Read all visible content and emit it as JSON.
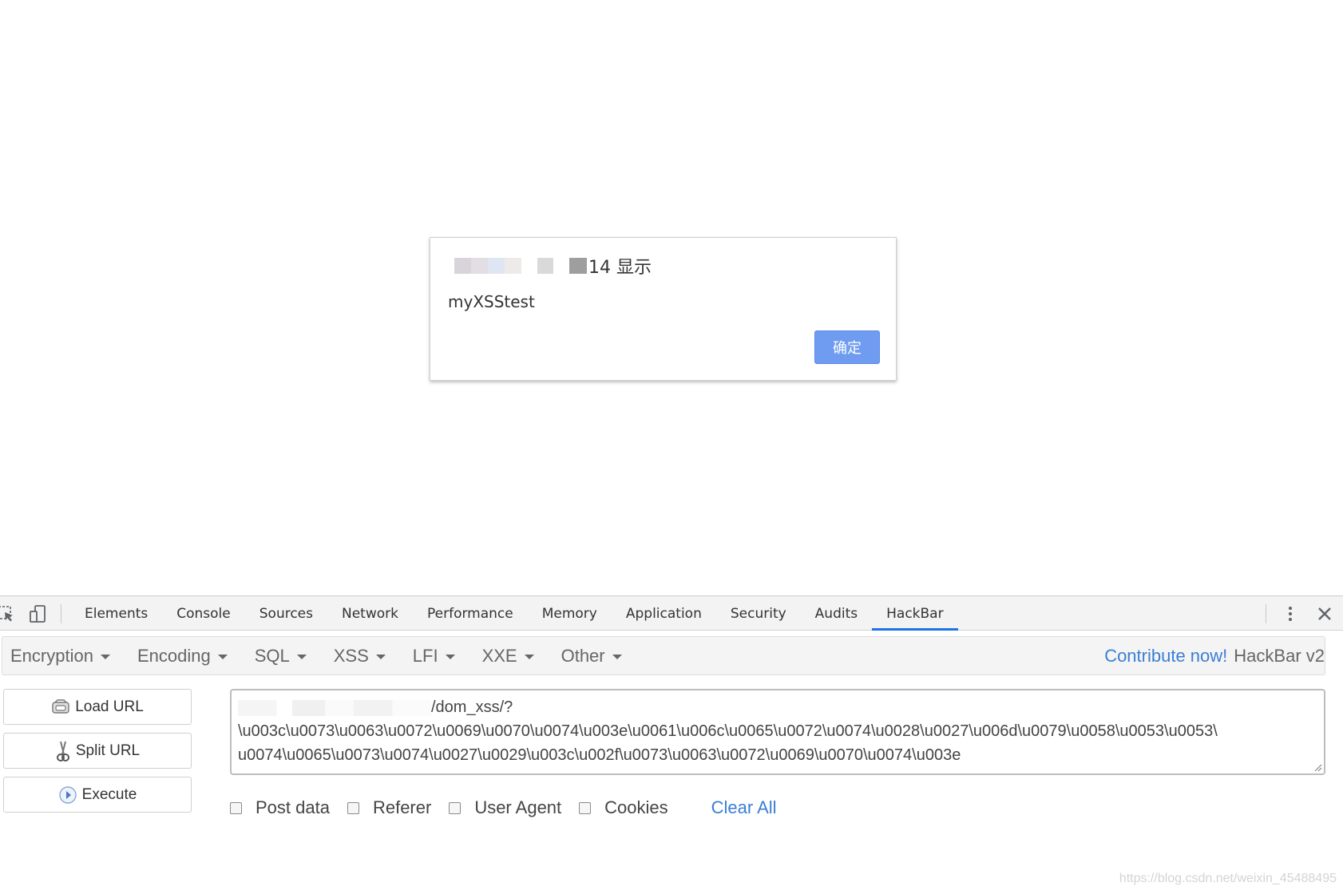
{
  "dialog": {
    "title_suffix": "14 显示",
    "message": "myXSStest",
    "ok_label": "确定"
  },
  "devtools": {
    "tabs": [
      {
        "label": "Elements"
      },
      {
        "label": "Console"
      },
      {
        "label": "Sources"
      },
      {
        "label": "Network"
      },
      {
        "label": "Performance"
      },
      {
        "label": "Memory"
      },
      {
        "label": "Application"
      },
      {
        "label": "Security"
      },
      {
        "label": "Audits"
      },
      {
        "label": "HackBar"
      }
    ],
    "active_tab": "HackBar",
    "accent_color": "#1a73e8"
  },
  "hackbar": {
    "menu": [
      {
        "label": "Encryption"
      },
      {
        "label": "Encoding"
      },
      {
        "label": "SQL"
      },
      {
        "label": "XSS"
      },
      {
        "label": "LFI"
      },
      {
        "label": "XXE"
      },
      {
        "label": "Other"
      }
    ],
    "contribute_label": "Contribute now!",
    "version_label": "HackBar v2",
    "buttons": {
      "load_url": "Load URL",
      "split_url": "Split URL",
      "execute": "Execute"
    },
    "url": {
      "line1_suffix": "/dom_xss/?",
      "line2": "\\u003c\\u0073\\u0063\\u0072\\u0069\\u0070\\u0074\\u003e\\u0061\\u006c\\u0065\\u0072\\u0074\\u0028\\u0027\\u006d\\u0079\\u0058\\u0053\\u0053\\",
      "line3": "u0074\\u0065\\u0073\\u0074\\u0027\\u0029\\u003c\\u002f\\u0073\\u0063\\u0072\\u0069\\u0070\\u0074\\u003e"
    },
    "options": {
      "post_data": "Post data",
      "referer": "Referer",
      "user_agent": "User Agent",
      "cookies": "Cookies",
      "clear_all": "Clear All"
    },
    "link_color": "#3b7ed4"
  },
  "watermark": "https://blog.csdn.net/weixin_45488495"
}
